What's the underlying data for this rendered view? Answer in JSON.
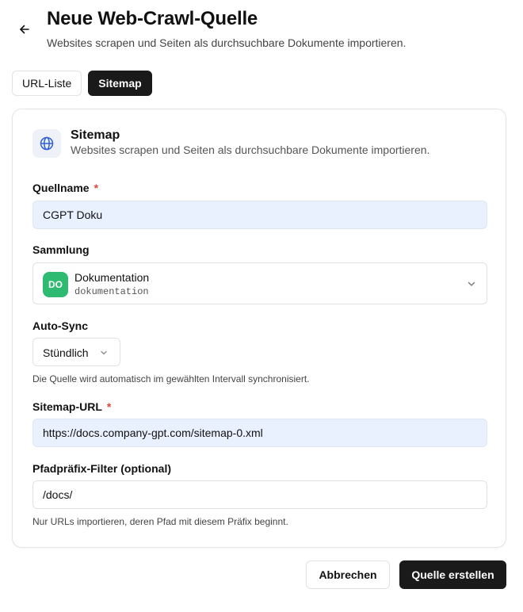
{
  "header": {
    "title": "Neue Web-Crawl-Quelle",
    "subtitle": "Websites scrapen und Seiten als durchsuchbare Dokumente importieren.",
    "back_icon": "arrow-left-icon"
  },
  "tabs": [
    {
      "label": "URL-Liste",
      "active": false
    },
    {
      "label": "Sitemap",
      "active": true
    }
  ],
  "card": {
    "icon": "globe-icon",
    "title": "Sitemap",
    "subtitle": "Websites scrapen und Seiten als durchsuchbare Dokumente importieren."
  },
  "form": {
    "source_name": {
      "label": "Quellname",
      "required_mark": "*",
      "value": "CGPT Doku"
    },
    "collection": {
      "label": "Sammlung",
      "avatar": "DO",
      "avatar_color": "#2fba72",
      "name": "Dokumentation",
      "slug": "dokumentation"
    },
    "auto_sync": {
      "label": "Auto-Sync",
      "value": "Stündlich",
      "help": "Die Quelle wird automatisch im gewählten Intervall synchronisiert."
    },
    "sitemap_url": {
      "label": "Sitemap-URL",
      "required_mark": "*",
      "value": "https://docs.company-gpt.com/sitemap-0.xml"
    },
    "path_prefix": {
      "label": "Pfadpräfix-Filter (optional)",
      "value": "/docs/",
      "help": "Nur URLs importieren, deren Pfad mit diesem Präfix beginnt."
    }
  },
  "footer": {
    "cancel_label": "Abbrechen",
    "create_label": "Quelle erstellen"
  },
  "colors": {
    "primary": "#1a1a1a",
    "required": "#e0463a",
    "input_filled_bg": "#e9f0fe"
  }
}
